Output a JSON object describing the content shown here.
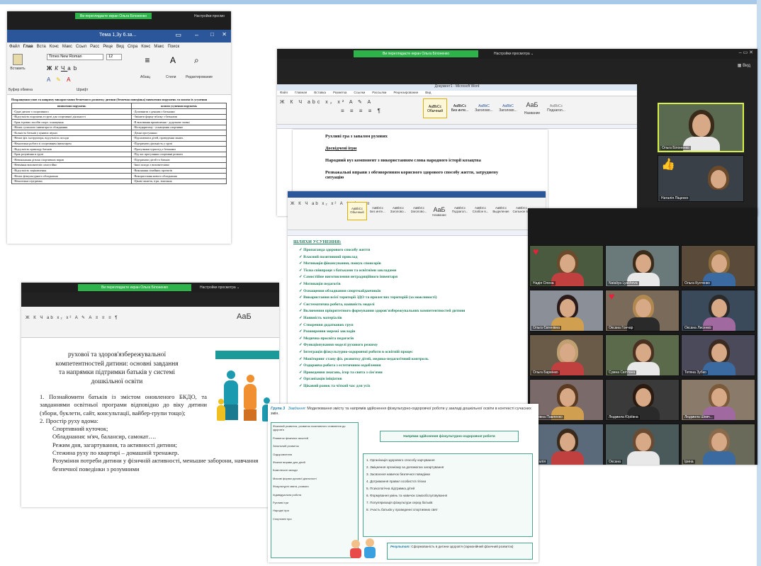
{
  "zoom": {
    "share_label_olga": "Ви переглядаєте екран Ольга Білоненко",
    "view_options": "Настройки просмотра",
    "view_options_short": "Настройки просмо",
    "view_label": "Вид"
  },
  "word_left": {
    "title": "Тема 1,3у 6.за...",
    "tabs": [
      "Файл",
      "Глав",
      "Вста",
      "Конс",
      "Макс",
      "Ссыл",
      "Расс",
      "Реце",
      "Вид",
      "Спра",
      "Конс",
      "Макс",
      "Поиск"
    ],
    "font_name": "Times New Roman",
    "font_size": "12",
    "paste_label": "Вставить",
    "clipboard_label": "Буфер обмена",
    "font_label": "Шрифт",
    "paragraph_label": "Абзац",
    "styles_label": "Стили",
    "editing_label": "Редактирование",
    "heading": "Покращення умов та напряму використання безпечного розвитку дитини (безпечна поведінка) виявлення порушень та шляхи їх усунення",
    "col1": "виявлення порушень",
    "col2": "шляхи усунення порушень",
    "rows": [
      [
        "-Одне дитяче з спортивного",
        "-Доповнити з денним з батьками"
      ],
      [
        "-Відсутність порушень в групі для спортивної діяльності",
        "-Змінити форму зв'язку з батьками"
      ],
      [
        "-Брак ігрових засобів спорт. оснащення",
        "-В виховання примішення - додаткове ззовні"
      ],
      [
        "-Немає сучасного інвентаря та обладнання",
        "-На відкритому - оснащення спортивне"
      ],
      [
        "-Кількість батьків у цікавих звуках",
        "-Денні прогулянки"
      ],
      [
        "-Немає фіз. інструктора, відсутність посади",
        "-Підсилювати дітей, проведення занять"
      ],
      [
        "-Неналежна робота зі спортивним інвентарем",
        "-Підтримати діяльність у групі"
      ],
      [
        "-Відсутність прикладу батьків",
        "-Прогулянки турпохід з батьками"
      ],
      [
        "-Брак розуміння в групі",
        "-Під час прогулянки спортивні розваги"
      ],
      [
        "-Невиконання дітьми спортивних вправ",
        "-Підтримати дітей та батьків"
      ],
      [
        "-Невміння вихователів самостійно",
        "-Інші заходи з вихователями"
      ],
      [
        "-Відсутність зацікавлення",
        "-Виконання сімейних проектів"
      ],
      [
        "-Немає фізкультурного обладнання",
        "-Використання нового обладнання"
      ],
      [
        "-Неналежна підтримка",
        "-Цікаві заняття, ігри, змагання"
      ]
    ]
  },
  "zoom_right": {
    "view_label": "Вид",
    "word_title": "Документ1 - Microsoft Word",
    "tabs": [
      "Файл",
      "Главная",
      "Вставка",
      "Разметка",
      "Ссылки",
      "Рассылки",
      "Рецензирование",
      "Вид"
    ],
    "styles": [
      "Обычный",
      "Без инте...",
      "Заголово...",
      "Заголово...",
      "Название",
      "Подзагол...",
      "Слабое в..."
    ],
    "style_sample_big": "AaБ",
    "doc_lines": [
      "Рухливі гра з запалом рухових",
      "Досвідчені ігри",
      "Народний вуз компонент з використанням слова народного історії козацтва",
      "Розважальні вправи з обговоренням корисного здорового способу життя, затруднену ситуацію"
    ],
    "participants_top": [
      {
        "name": "Ольга Білоненко"
      },
      {
        "name": "Наталія Ліщенко"
      }
    ],
    "thumb_icon": "👍"
  },
  "list_doc": {
    "title": "ШЛЯХИ УСУНЕННЯ:",
    "items": [
      "Пропаганда здорового способу життя",
      "Власний позитивний приклад",
      "Мотивація фінансування, пошук спонсорів",
      "Тісна співпраця з батьками та освітніми закладами",
      "Самостійне виготовлення нетрадиційного інвентаря",
      "Мотивація педагогів",
      "Оснащення обладнання спортмайданчиків",
      "Використання всієї території ЗДО та прилеглих територій (за можливості)",
      "Систематична робота, наявність моделі",
      "Включення пріоритетного формування здоров'язбережувальних компетентностей дитини",
      "Наявність матеріалів",
      "Створення додаткових груп",
      "Розширення мережі закладів",
      "Медична просвіта педагогів",
      "Функціонування моделі рухового режиму",
      "Інтеграція фізкультурно-оздоровчої роботи в освітній процес",
      "Моніторинг стану фіз. розвитку дітей, медико-педагогічний контроль",
      "Оздоровча робота з естетичним оздоблення",
      "Проведення змагань, ігор та свята з сім'ями",
      "Організація ініціатив",
      "Цікавий ранок та чіткий час для усіх"
    ],
    "styles": [
      "Обычный",
      "Без инте...",
      "Заголово...",
      "Заголово...",
      "Название",
      "Подзагол...",
      "Слабое в...",
      "Выделение",
      "Сильное в..."
    ],
    "style_sample_big": "AaБ"
  },
  "gallery": {
    "tiles": [
      {
        "name": "Надія Олена",
        "heart": true
      },
      {
        "name": "Nataliya Lyakhova",
        "heart": false
      },
      {
        "name": "Ольга Кухтенко",
        "heart": false
      },
      {
        "name": "Ольга Євгенівна",
        "heart": false
      },
      {
        "name": "Оксана Гончар",
        "heart": true
      },
      {
        "name": "Оксана Лисенко",
        "heart": false
      },
      {
        "name": "Ольга Барвінко",
        "heart": false
      },
      {
        "name": "Сумна Світлана",
        "heart": false
      },
      {
        "name": "Тетяна Зубко",
        "heart": false
      },
      {
        "name": "Ігорівна Павленко",
        "heart": false
      },
      {
        "name": "Людмила Юріївна",
        "heart": false
      },
      {
        "name": "Людмила Шевч...",
        "heart": false
      },
      {
        "name": "Наталія",
        "heart": false
      },
      {
        "name": "Оксана",
        "heart": false
      },
      {
        "name": "Ірина",
        "heart": false
      }
    ]
  },
  "slide_left": {
    "title_lines": [
      "рухової та здоров'язбережувальної",
      "компетентностей дитини: основні завдання",
      "та напрямки підтримки батьків у системі",
      "дошкільної освіти"
    ],
    "items": [
      "1. Познайомити батьків із змістом оновленого БКДО, та завданнями освітньої програми відповідно до віку дитини (збори, буклети, сайт, консультації, вайбер-групи тощо);",
      "2. Простір руху вдома:",
      "Спортивний куточок;",
      "Обладнання: м'яч, балансир, самокат….",
      "Режим дня, загартування, та активності дитини;",
      "Стежина руху по квартирі – домашній тренажер.",
      "Розуміння потреби дитини у фізичній активності, меньшие заборони, навчання безпечної поведінки з розумними"
    ]
  },
  "group_panel": {
    "group_label": "Група 3",
    "task_label": "Завдання:",
    "task_text": "Моделювання змісту та напрямів здійснення фізкультурно-оздоровчої роботи у закладі дошкільної освіти в контексті сучасних змін.",
    "center_box": "Напрями здійснення фізкультурно-оздоровчої роботи",
    "left_list": [
      "Фізичний розвиток, розвиток позитивного ставлення до здоров'я",
      "Розвиток фізичних якостей",
      "Загальний розвиток",
      "Оздоровлення",
      "Фізичні вправи для дітей",
      "Комплексні заходи",
      "Масові форми рухової діяльності",
      "Фізкультурні свята, розваги",
      "Індивідуальна робота",
      "Рухливі ігри",
      "Народні ігри",
      "Спортивні ігри"
    ],
    "right_list": [
      "1. Організація здорового способу харчування",
      "2. Зміцнення організму за допомогою загартування",
      "3. Засвоєння навичок безпечної поведінки",
      "4. Дотримання правил особистої гігієни",
      "5. Психологічна підтримка дітей",
      "6. Формування умінь та навичок самообслуговування",
      "7. Популяризація фізкультури серед батьків",
      "8. Участь батьків у проведенні спортивних свят"
    ],
    "result_label": "Результат:",
    "result_text": "Сформованість в дитини здоров'я (гармонійний фізичний розвиток)"
  },
  "colors": {
    "zoom_dark": "#1e1e1e",
    "zoom_green": "#2db34a",
    "word_blue": "#2b579a",
    "list_green": "#1a7a55",
    "frame_blue": "#a8c8e8"
  }
}
